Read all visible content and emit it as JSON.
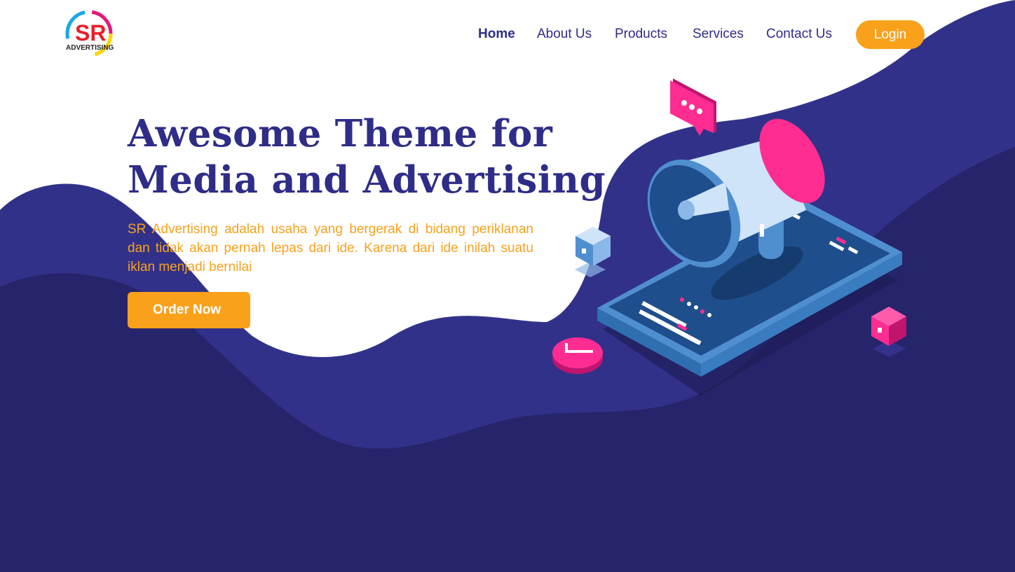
{
  "brand": {
    "logo_text": "SR",
    "logo_subtext": "ADVERTISING"
  },
  "nav": {
    "items": [
      {
        "label": "Home",
        "active": true
      },
      {
        "label": "About Us",
        "active": false
      },
      {
        "label": "Products",
        "active": false
      },
      {
        "label": "Services",
        "active": false
      },
      {
        "label": "Contact Us",
        "active": false
      }
    ],
    "login_label": "Login"
  },
  "hero": {
    "title_line1": "Awesome Theme for",
    "title_line2": "Media and Advertising",
    "description": "SR Advertising adalah usaha yang bergerak di bidang periklanan dan tidak akan pernah lepas dari ide. Karena dari ide inilah suatu iklan menjadi bernilai",
    "cta_label": "Order Now"
  },
  "colors": {
    "primary": "#2e2d87",
    "primary_dark": "#252566",
    "accent": "#f9a11b",
    "pink": "#ff2d91",
    "light_blue": "#cfe4f8"
  },
  "illustration": {
    "icons": [
      "megaphone-icon",
      "smartphone-icon",
      "chat-bubble-icon",
      "clock-icon",
      "blue-cube-icon",
      "pink-cube-icon"
    ]
  }
}
